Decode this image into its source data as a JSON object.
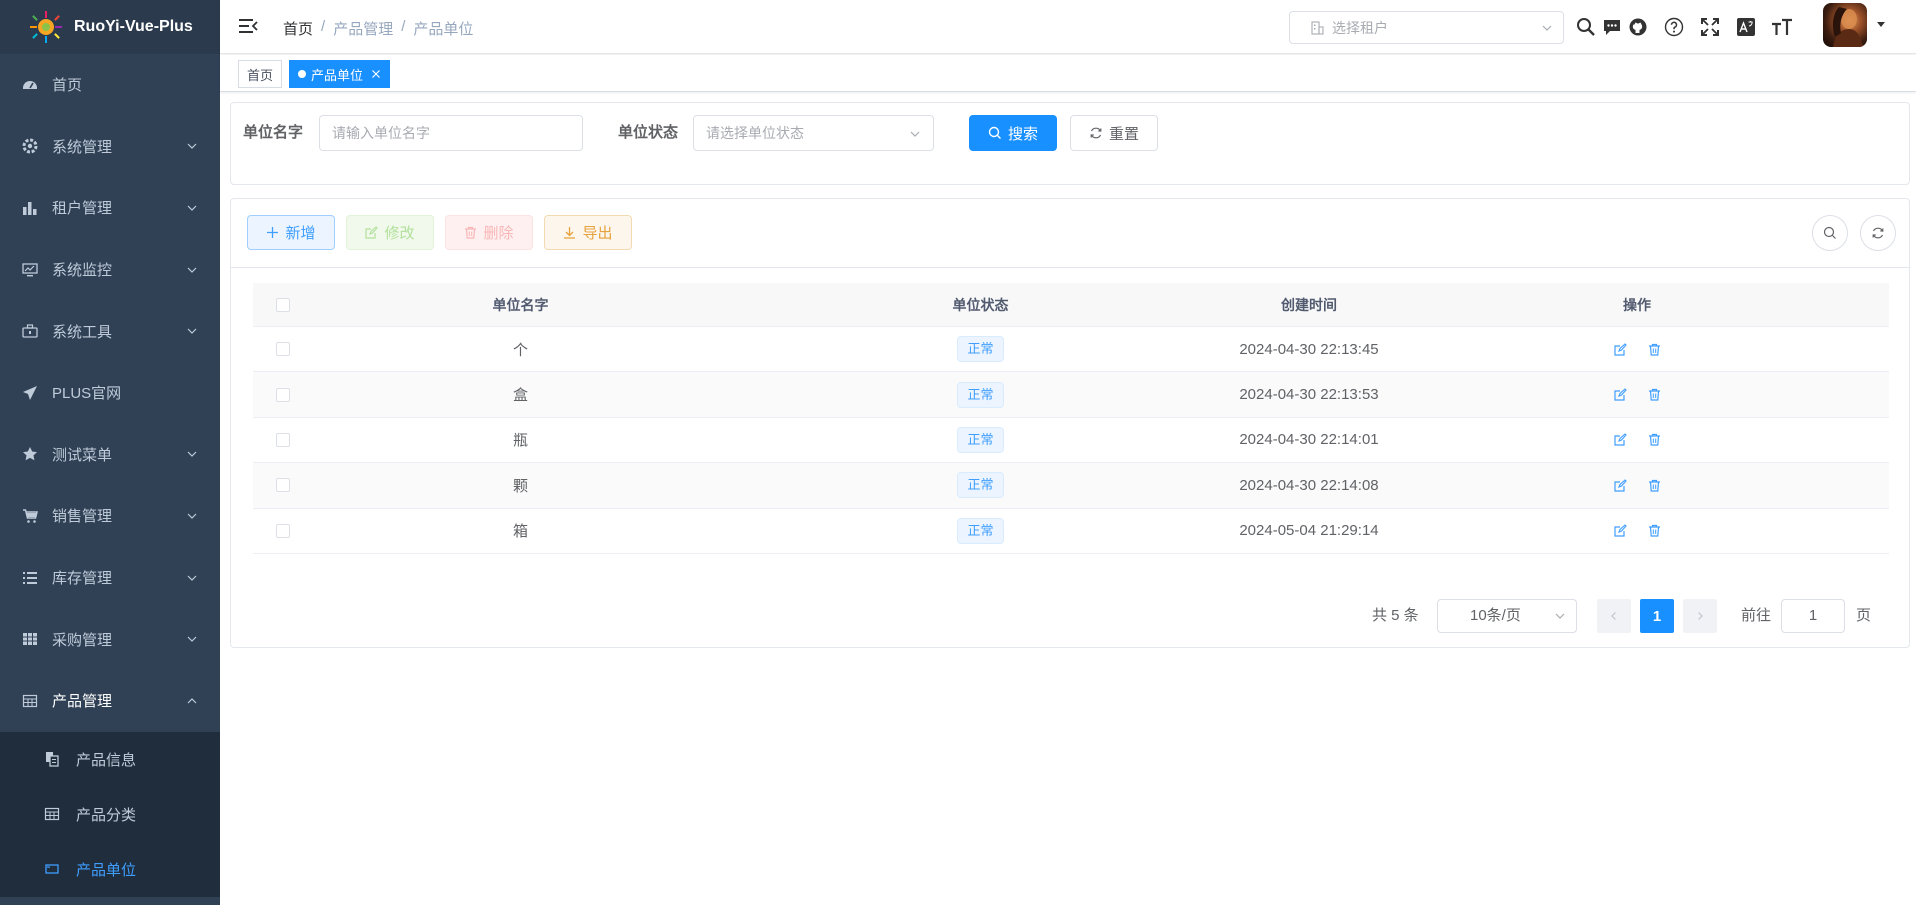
{
  "app": {
    "title": "RuoYi-Vue-Plus"
  },
  "sidebar": {
    "items": [
      {
        "label": "首页",
        "icon": "dashboard-icon"
      },
      {
        "label": "系统管理",
        "icon": "gear-icon"
      },
      {
        "label": "租户管理",
        "icon": "chart-icon"
      },
      {
        "label": "系统监控",
        "icon": "monitor-icon"
      },
      {
        "label": "系统工具",
        "icon": "toolbox-icon"
      },
      {
        "label": "PLUS官网",
        "icon": "paper-plane-icon"
      },
      {
        "label": "测试菜单",
        "icon": "star-icon"
      },
      {
        "label": "销售管理",
        "icon": "cart-icon"
      },
      {
        "label": "库存管理",
        "icon": "list-icon"
      },
      {
        "label": "采购管理",
        "icon": "grid-icon"
      },
      {
        "label": "产品管理",
        "icon": "table-icon"
      }
    ],
    "sub_items": [
      {
        "label": "产品信息",
        "icon": "documents-icon"
      },
      {
        "label": "产品分类",
        "icon": "table-icon"
      },
      {
        "label": "产品单位",
        "icon": "rectangle-icon"
      }
    ]
  },
  "header": {
    "breadcrumb": [
      "首页",
      "产品管理",
      "产品单位"
    ],
    "breadcrumb_sep": "/",
    "tenant_placeholder": "选择租户"
  },
  "tags": [
    {
      "label": "首页"
    },
    {
      "label": "产品单位"
    }
  ],
  "search": {
    "name_label": "单位名字",
    "name_placeholder": "请输入单位名字",
    "status_label": "单位状态",
    "status_placeholder": "请选择单位状态",
    "search_button": "搜索",
    "reset_button": "重置"
  },
  "toolbar": {
    "add": "新增",
    "edit": "修改",
    "delete": "删除",
    "export": "导出"
  },
  "table": {
    "columns": [
      "单位名字",
      "单位状态",
      "创建时间",
      "操作"
    ],
    "rows": [
      {
        "name": "个",
        "status": "正常",
        "created": "2024-04-30 22:13:45"
      },
      {
        "name": "盒",
        "status": "正常",
        "created": "2024-04-30 22:13:53"
      },
      {
        "name": "瓶",
        "status": "正常",
        "created": "2024-04-30 22:14:01"
      },
      {
        "name": "颗",
        "status": "正常",
        "created": "2024-04-30 22:14:08"
      },
      {
        "name": "箱",
        "status": "正常",
        "created": "2024-05-04 21:29:14"
      }
    ]
  },
  "pagination": {
    "total": "共 5 条",
    "page_size": "10条/页",
    "current_page": "1",
    "goto_label": "前往",
    "goto_value": "1",
    "page_unit": "页"
  },
  "colors": {
    "sidebar_bg": "#304156",
    "primary": "#1890ff",
    "active_menu": "#409eff"
  }
}
